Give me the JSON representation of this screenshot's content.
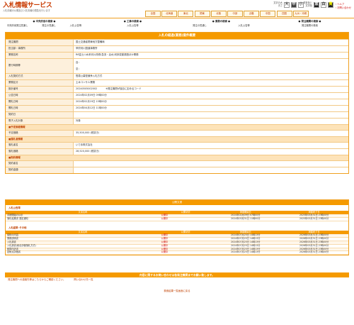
{
  "header": {
    "title": "入札情報サービス",
    "subtitle": "入札情報の公開及び入札情報の閲覧を行います",
    "font_size": {
      "caption": "文字の大きさ",
      "options": [
        "大",
        "中",
        "小"
      ],
      "selected": "中"
    },
    "contrast": {
      "caption": "背景色と文字色",
      "options": [
        "黒",
        "白",
        "黄"
      ]
    },
    "help_links": [
      "ヘルプ",
      "お問い合わせ"
    ]
  },
  "regions": [
    "全国",
    "北海道",
    "東北",
    "関東",
    "北陸",
    "中部",
    "近畿",
    "中国",
    "四国",
    "九州・沖縄"
  ],
  "nav": [
    {
      "title": "● 中央府省の検索 ●",
      "subs": [
        "中央府省発注見通し",
        "発注の見通し",
        "入札公告等"
      ]
    },
    {
      "title": "● 工事の検索 ●",
      "subs": [
        "入札公告等"
      ]
    },
    {
      "title": "● 業務の検索 ●",
      "subs": [
        "発注の見通し",
        "入札公告等"
      ]
    },
    {
      "title": "● 発注機関の検索 ●",
      "subs": [
        "発注機関の検索"
      ]
    }
  ],
  "detail": {
    "title": "入札の経過(業務)案件概要",
    "rows": [
      {
        "k": "発注機関",
        "v": "国土交通省関東地方整備局"
      },
      {
        "k": "担当部・事務所",
        "v": "甲府河川国道事務所"
      },
      {
        "k": "業務名称",
        "v": "R6富士川水系河川改修(急流・治水)河床変動調査ほか業務"
      }
    ],
    "location": {
      "k": "履行時期等",
      "v1": "自：",
      "v2": "至："
    },
    "rows2": [
      {
        "k": "入札契約方式",
        "v": "簡易公募型競争入札方式"
      },
      {
        "k": "業務区分",
        "v": "土木コンサル業務"
      }
    ],
    "bidno": {
      "k": "設計番号",
      "v": "20240505002002",
      "note": "※発注機関が独自に定めるコード"
    },
    "rows3": [
      {
        "k": "公告日時",
        "v": "2024年02月09日 09時00分"
      },
      {
        "k": "開札日時",
        "v": "2024年02月19日 15時00分"
      },
      {
        "k": "開札日時",
        "v": "2024年04月12日 11時00分"
      },
      {
        "k": "契約日",
        "v": ""
      },
      {
        "k": "電子入札対象",
        "v": "対象"
      }
    ],
    "sec1": "■予定価格情報",
    "price": {
      "k": "予定価格",
      "v": "35,500,000 (税抜き)"
    },
    "sec2": "■落札者情報",
    "winner": [
      {
        "k": "落札者名",
        "v": "いであ株式会社"
      },
      {
        "k": "落札価格",
        "v": "28,520,000 (税抜き)"
      }
    ],
    "sec3": "■契約情報",
    "contract": [
      {
        "k": "契約者名",
        "v": ""
      },
      {
        "k": "契約金額",
        "v": ""
      }
    ]
  },
  "docs": {
    "title": "公開文書",
    "headers": [
      "文書名称",
      "公開状況",
      "掲載開始日",
      "掲載終了日"
    ],
    "group1": {
      "name": "入札公告等",
      "rows": [
        [
          "手続開始の公示",
          "公開中",
          "2024年02月09日 07時00分",
          "2025年03月31日 23時00分"
        ],
        [
          "落札結果書 選定通知",
          "公開中",
          "2024年03月31日 11時00分",
          "2025年03月31日 23時00分"
        ]
      ]
    },
    "group2": {
      "name": "入札結果･その他",
      "rows": [
        [
          "契約の内容",
          "公開中",
          "2024年07月25日 14時13分",
          "2026年03月31日 23時00分"
        ],
        [
          "業務説明書",
          "公開中",
          "2024年07月25日 14時13分",
          "2026年03月31日 23時00分"
        ],
        [
          "入札調書",
          "公開中",
          "2024年07月25日 14時13分",
          "2026年03月31日 23時00分"
        ],
        [
          "入札調書(総合評価落札方式)",
          "公開中",
          "2024年07月25日 14時13分",
          "2026年03月31日 23時00分"
        ],
        [
          "積算内訳書",
          "公開中",
          "2024年07月25日 14時13分",
          "2026年03月31日 23時00分"
        ],
        [
          "技術点評価書",
          "公開中",
          "2024年07月25日 14時13分",
          "2026年03月31日 23時00分"
        ]
      ]
    }
  },
  "footer": {
    "banner": "内容に関するお問い合わせは各発注機関までお願い致します。",
    "links": [
      "発注機関への連絡先等はこちらからご確認ください。",
      "問い合わせ先一覧"
    ],
    "back": "検索結果一覧画面に戻る"
  }
}
